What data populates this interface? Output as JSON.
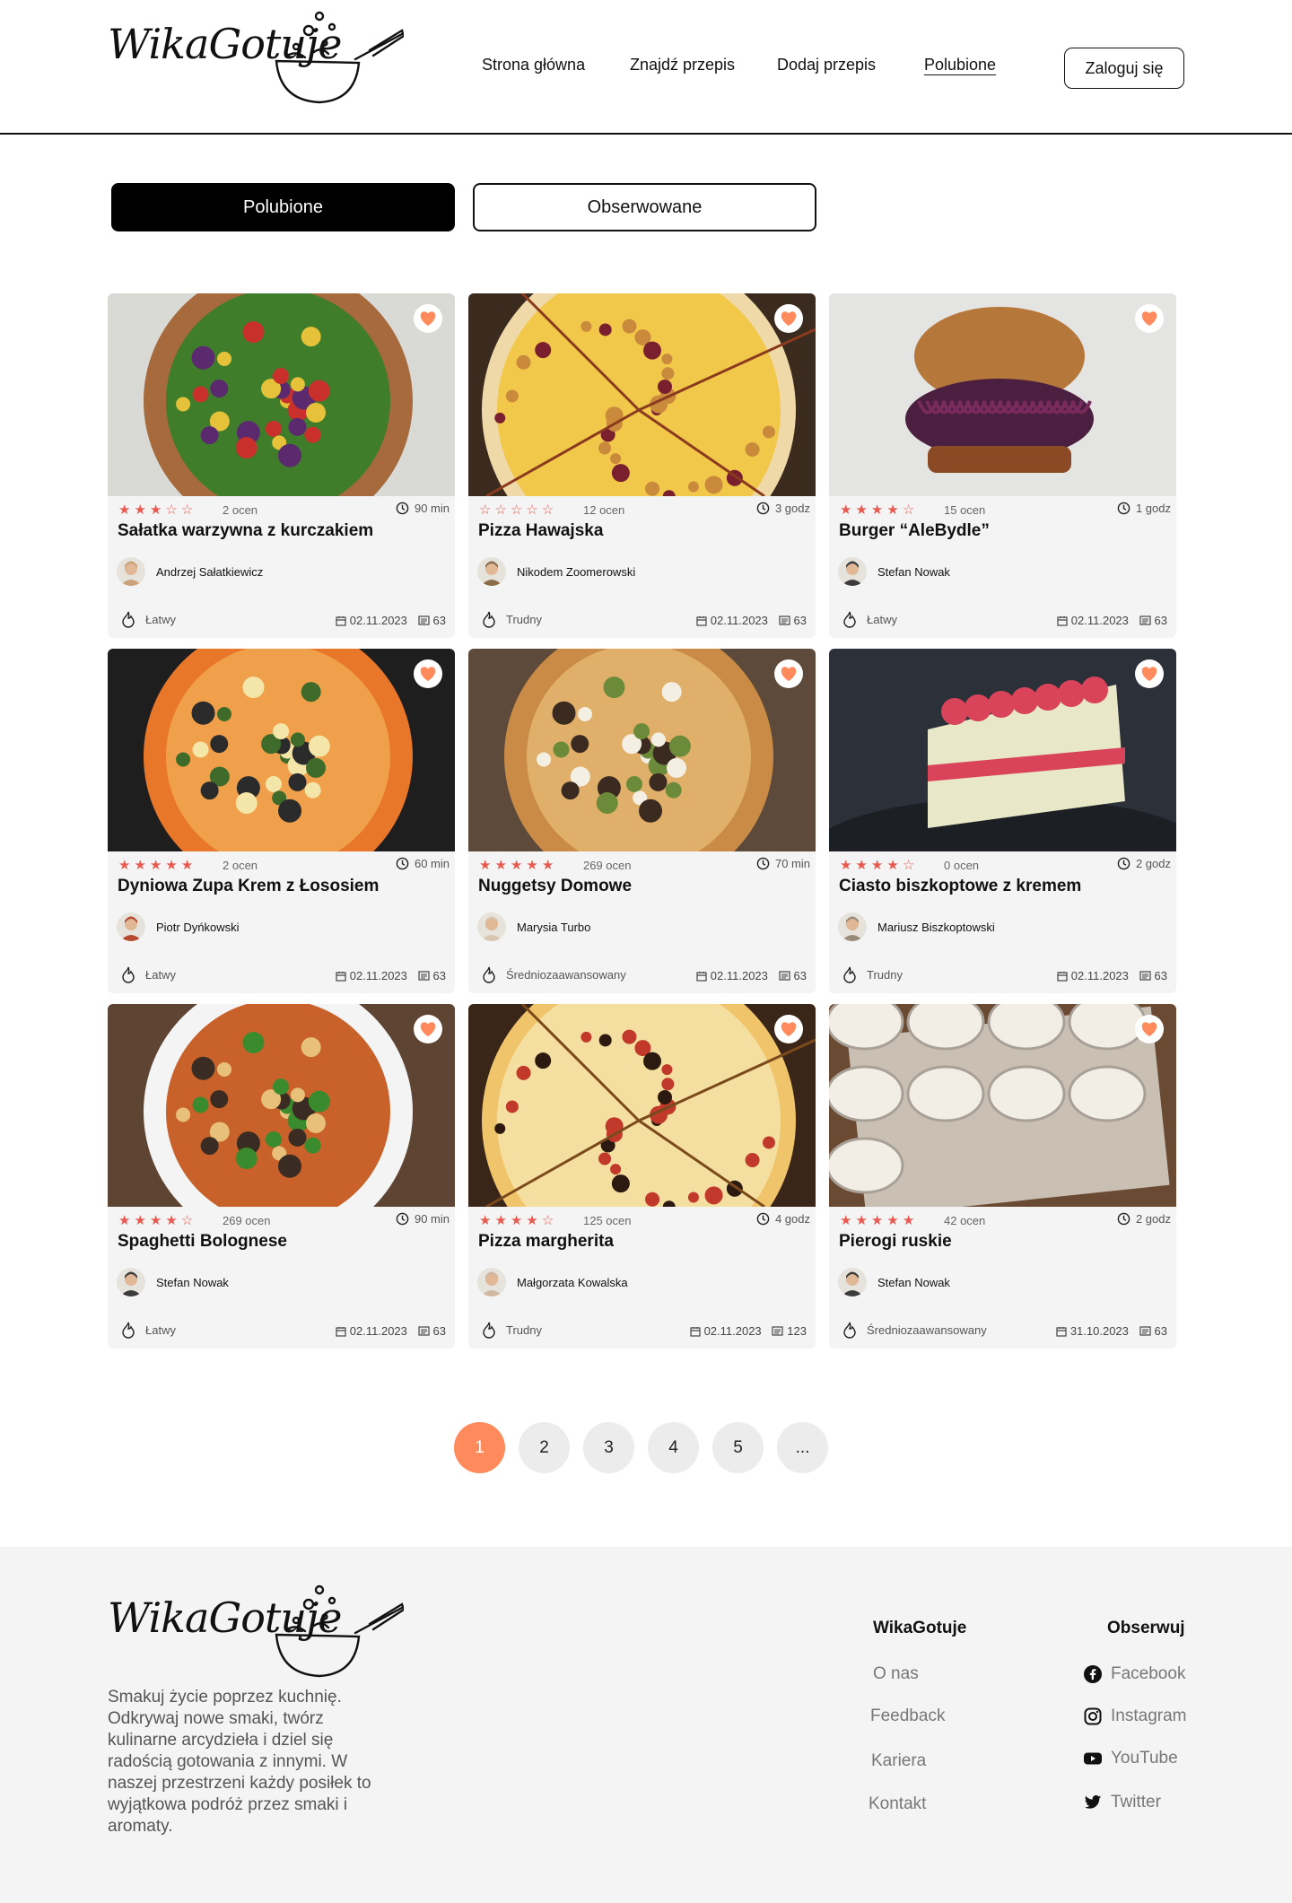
{
  "brand": {
    "name": "WikaGotuje"
  },
  "nav": [
    {
      "label": "Strona główna"
    },
    {
      "label": "Znajdź przepis"
    },
    {
      "label": "Dodaj przepis"
    },
    {
      "label": "Polubione"
    }
  ],
  "login_label": "Zaloguj się",
  "tabs": [
    {
      "label": "Polubione"
    },
    {
      "label": "Obserwowane"
    }
  ],
  "colors": {
    "accent": "#ff8a5c",
    "stars": "#e85a4f",
    "tab_active": "#000000",
    "footer_bg": "#f4f4f4"
  },
  "recipes": [
    {
      "title": "Sałatka warzywna z kurczakiem",
      "stars": 3,
      "ratings": "2 ocen",
      "time": "90 min",
      "author": "Andrzej Sałatkiewicz",
      "difficulty": "Łatwy",
      "date": "02.11.2023",
      "comments": "63"
    },
    {
      "title": "Pizza Hawajska",
      "stars": 0,
      "ratings": "12 ocen",
      "time": "3 godz",
      "author": "Nikodem Zoomerowski",
      "difficulty": "Trudny",
      "date": "02.11.2023",
      "comments": "63"
    },
    {
      "title": "Burger “AleBydle”",
      "stars": 4,
      "ratings": "15 ocen",
      "time": "1 godz",
      "author": "Stefan Nowak",
      "difficulty": "Łatwy",
      "date": "02.11.2023",
      "comments": "63"
    },
    {
      "title": "Dyniowa Zupa Krem z Łososiem",
      "stars": 5,
      "ratings": "2 ocen",
      "time": "60 min",
      "author": "Piotr Dyńkowski",
      "difficulty": "Łatwy",
      "date": "02.11.2023",
      "comments": "63"
    },
    {
      "title": "Nuggetsy Domowe",
      "stars": 5,
      "ratings": "269 ocen",
      "time": "70 min",
      "author": "Marysia Turbo",
      "difficulty": "Średniozaawansowany",
      "date": "02.11.2023",
      "comments": "63"
    },
    {
      "title": "Ciasto biszkoptowe z kremem",
      "stars": 4,
      "ratings": "0 ocen",
      "time": "2 godz",
      "author": "Mariusz Biszkoptowski",
      "difficulty": "Trudny",
      "date": "02.11.2023",
      "comments": "63"
    },
    {
      "title": "Spaghetti Bolognese",
      "stars": 4,
      "ratings": "269 ocen",
      "time": "90 min",
      "author": "Stefan Nowak",
      "difficulty": "Łatwy",
      "date": "02.11.2023",
      "comments": "63"
    },
    {
      "title": "Pizza margherita",
      "stars": 4,
      "ratings": "125 ocen",
      "time": "4 godz",
      "author": "Małgorzata Kowalska",
      "difficulty": "Trudny",
      "date": "02.11.2023",
      "comments": "123"
    },
    {
      "title": "Pierogi ruskie",
      "stars": 5,
      "ratings": "42 ocen",
      "time": "2 godz",
      "author": "Stefan Nowak",
      "difficulty": "Średniozaawansowany",
      "date": "31.10.2023",
      "comments": "63"
    }
  ],
  "pagination": [
    "1",
    "2",
    "3",
    "4",
    "5",
    "..."
  ],
  "footer": {
    "description": "Smakuj życie poprzez kuchnię. Odkrywaj nowe smaki, twórz kulinarne arcydzieła i dziel się radością gotowania z innymi. W naszej przestrzeni każdy posiłek to wyjątkowa podróż przez smaki i aromaty.",
    "col1_title": "WikaGotuje",
    "col1_links": [
      "O nas",
      "Feedback",
      "Kariera",
      "Kontakt"
    ],
    "col2_title": "Obserwuj",
    "social": [
      {
        "label": "Facebook",
        "icon": "facebook-icon"
      },
      {
        "label": "Instagram",
        "icon": "instagram-icon"
      },
      {
        "label": "YouTube",
        "icon": "youtube-icon"
      },
      {
        "label": "Twitter",
        "icon": "twitter-icon"
      }
    ]
  }
}
